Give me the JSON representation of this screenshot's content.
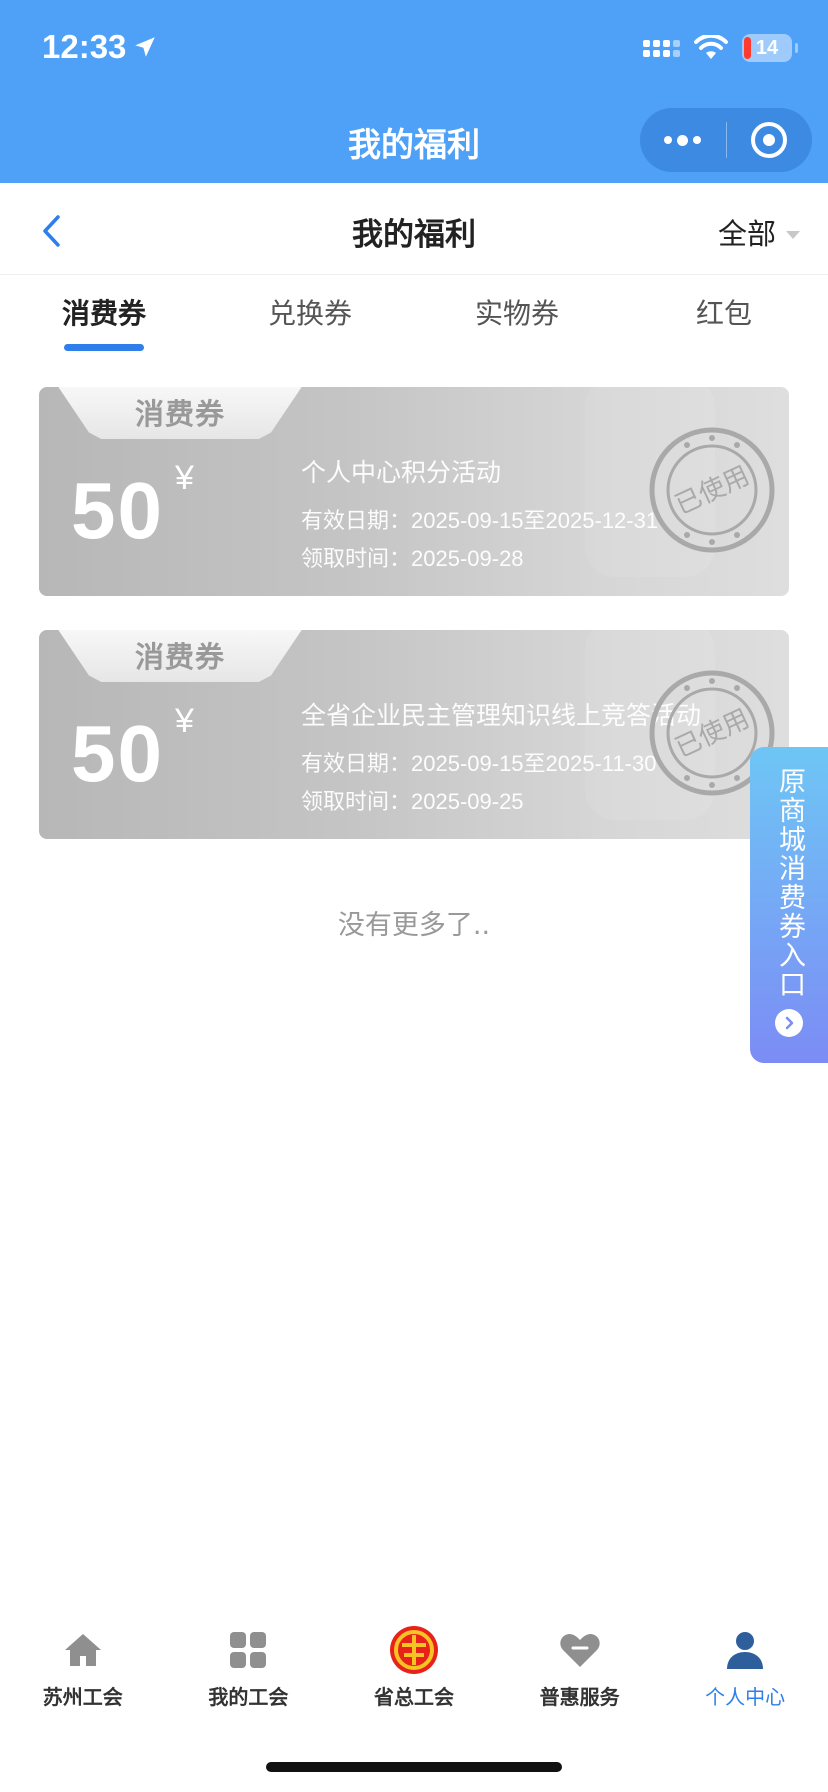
{
  "status_bar": {
    "time": "12:33",
    "battery": "14"
  },
  "miniprogram": {
    "title": "我的福利"
  },
  "header": {
    "title": "我的福利",
    "filter_label": "全部"
  },
  "tabs": [
    {
      "label": "消费券",
      "active": true
    },
    {
      "label": "兑换券",
      "active": false
    },
    {
      "label": "实物券",
      "active": false
    },
    {
      "label": "红包",
      "active": false
    }
  ],
  "coupons": [
    {
      "tag": "消费券",
      "amount": "50",
      "currency": "¥",
      "name": "个人中心积分活动",
      "validity": "有效日期：2025-09-15至2025-12-31",
      "received": "领取时间：2025-09-28",
      "stamp": "已使用"
    },
    {
      "tag": "消费券",
      "amount": "50",
      "currency": "¥",
      "name": "全省企业民主管理知识线上竞答活动",
      "validity": "有效日期：2025-09-15至2025-11-30",
      "received": "领取时间：2025-09-25",
      "stamp": "已使用"
    }
  ],
  "list_end_text": "没有更多了..",
  "side_entry": {
    "label": "原商城消费券入口"
  },
  "tabbar": [
    {
      "label": "苏州工会",
      "icon": "home-icon",
      "active": false
    },
    {
      "label": "我的工会",
      "icon": "grid-icon",
      "active": false
    },
    {
      "label": "省总工会",
      "icon": "union-emblem-icon",
      "active": false
    },
    {
      "label": "普惠服务",
      "icon": "heart-icon",
      "active": false
    },
    {
      "label": "个人中心",
      "icon": "person-icon",
      "active": true
    }
  ],
  "colors": {
    "primary": "#4fa0f7",
    "accent": "#2f7fea",
    "coupon_used": "#c4c4c4"
  }
}
